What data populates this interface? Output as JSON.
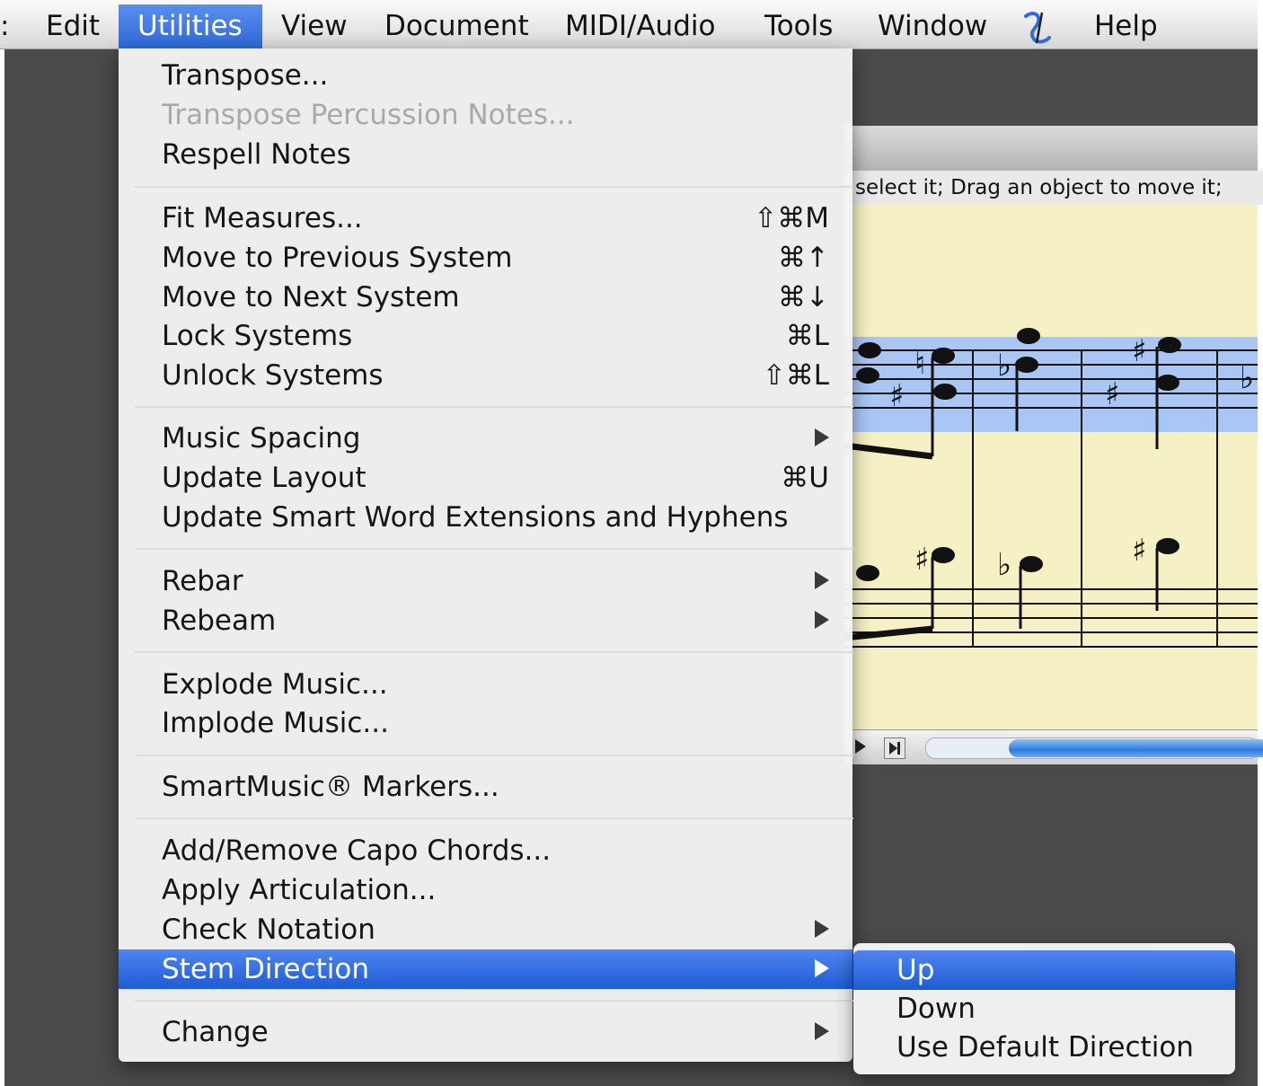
{
  "menubar": {
    "items": [
      {
        "label": "Edit",
        "active": false
      },
      {
        "label": "Utilities",
        "active": true
      },
      {
        "label": "View",
        "active": false
      },
      {
        "label": "Document",
        "active": false
      },
      {
        "label": "MIDI/Audio",
        "active": false
      },
      {
        "label": "Tools",
        "active": false
      },
      {
        "label": "Window",
        "active": false
      },
      {
        "label": "Help",
        "active": false
      }
    ],
    "script_icon": "script-menu-icon",
    "accent_color": "#3a72e0"
  },
  "document": {
    "status_text": "select it; Drag an object to move it;",
    "staff_selection_color": "#a9c6f7",
    "paper_color": "#f6f1c4"
  },
  "utilities_menu": {
    "items": [
      {
        "label": "Transpose..."
      },
      {
        "label": "Transpose Percussion Notes...",
        "disabled": true
      },
      {
        "label": "Respell Notes"
      },
      {
        "label": "Fit Measures...",
        "shortcut": "⇧⌘M"
      },
      {
        "label": "Move to Previous System",
        "shortcut": "⌘↑"
      },
      {
        "label": "Move to Next System",
        "shortcut": "⌘↓"
      },
      {
        "label": "Lock Systems",
        "shortcut": "⌘L"
      },
      {
        "label": "Unlock Systems",
        "shortcut": "⇧⌘L"
      },
      {
        "label": "Music Spacing",
        "submenu": true
      },
      {
        "label": "Update Layout",
        "shortcut": "⌘U"
      },
      {
        "label": "Update Smart Word Extensions and Hyphens"
      },
      {
        "label": "Rebar",
        "submenu": true
      },
      {
        "label": "Rebeam",
        "submenu": true
      },
      {
        "label": "Explode Music..."
      },
      {
        "label": "Implode Music..."
      },
      {
        "label": "SmartMusic® Markers..."
      },
      {
        "label": "Add/Remove Capo Chords..."
      },
      {
        "label": "Apply Articulation..."
      },
      {
        "label": "Check Notation",
        "submenu": true
      },
      {
        "label": "Stem Direction",
        "submenu": true,
        "highlighted": true
      },
      {
        "label": "Change",
        "submenu": true
      }
    ]
  },
  "stem_submenu": {
    "items": [
      {
        "label": "Up",
        "highlighted": true
      },
      {
        "label": "Down"
      },
      {
        "label": "Use Default Direction"
      }
    ]
  }
}
